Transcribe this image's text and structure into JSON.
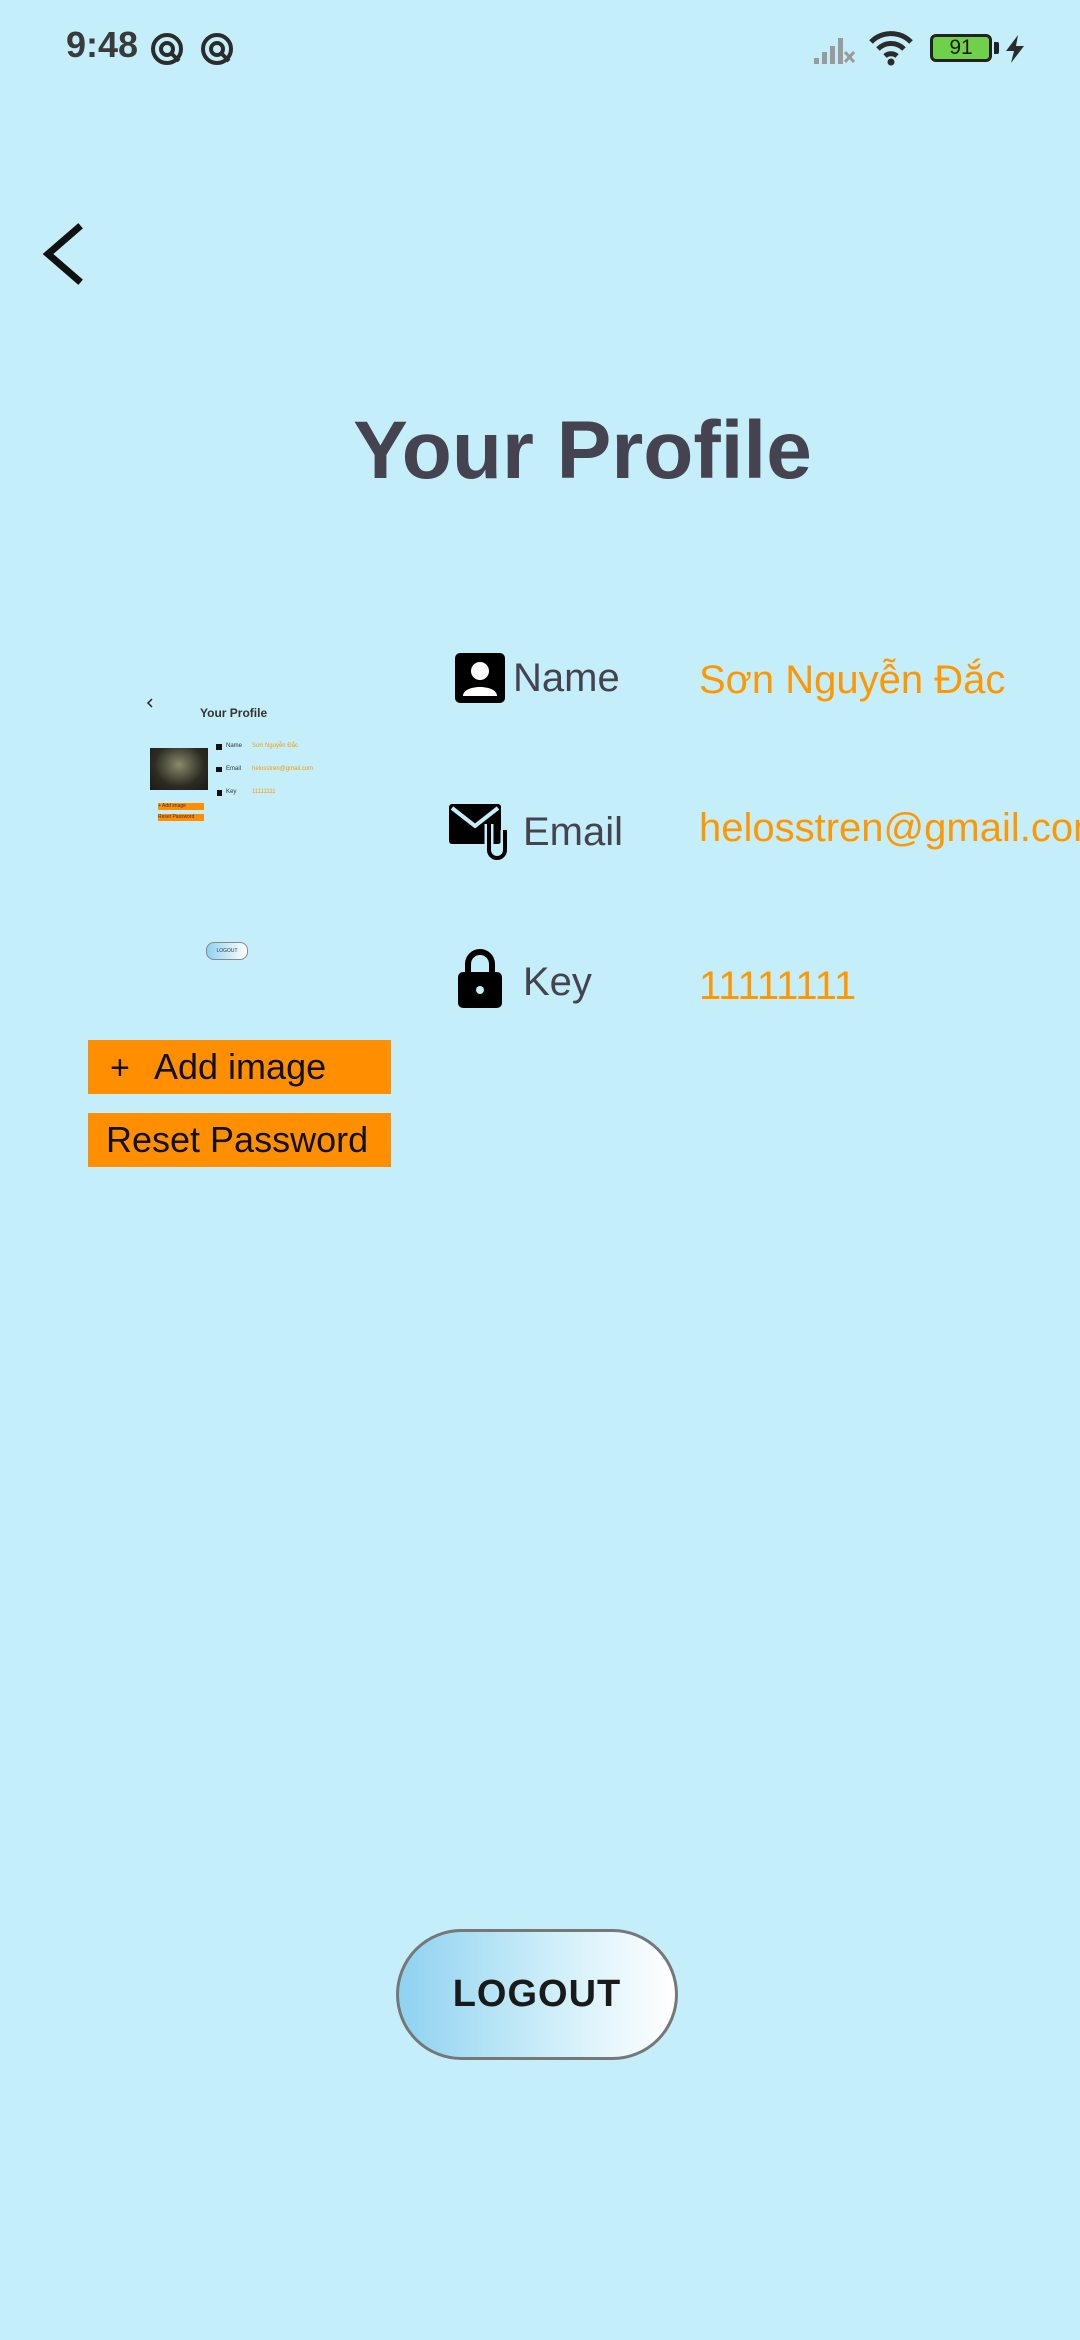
{
  "status_bar": {
    "time": "9:48",
    "battery": "91",
    "icons": [
      "notification-icon",
      "notification-icon",
      "signal-icon",
      "wifi-icon",
      "battery-icon",
      "charging-icon"
    ]
  },
  "header": {
    "back_icon": "chevron-left-icon",
    "title": "Your Profile"
  },
  "thumbnail": {
    "title": "Your Profile",
    "rows": [
      {
        "label": "Name",
        "value": "Sơn Nguyễn Đắc"
      },
      {
        "label": "Email",
        "value": "helosstren@gmail.com"
      },
      {
        "label": "Key",
        "value": "11111111"
      }
    ],
    "buttons": [
      "+ Add image",
      "Reset Password"
    ],
    "logout": "LOGOUT"
  },
  "actions": {
    "add_image_plus": "+",
    "add_image": "Add image",
    "reset_password": "Reset Password"
  },
  "profile": {
    "rows": [
      {
        "icon": "user-icon",
        "label": "Name",
        "value": "Sơn Nguyễn Đắc"
      },
      {
        "icon": "mail-attachment-icon",
        "label": "Email",
        "value": "helosstren@gmail.com"
      },
      {
        "icon": "lock-icon",
        "label": "Key",
        "value": "11111111"
      }
    ]
  },
  "logout": "LOGOUT",
  "colors": {
    "background": "#c4eefa",
    "accent": "#ff8f00",
    "value_text": "#ff9800",
    "title_text": "#45434f"
  }
}
